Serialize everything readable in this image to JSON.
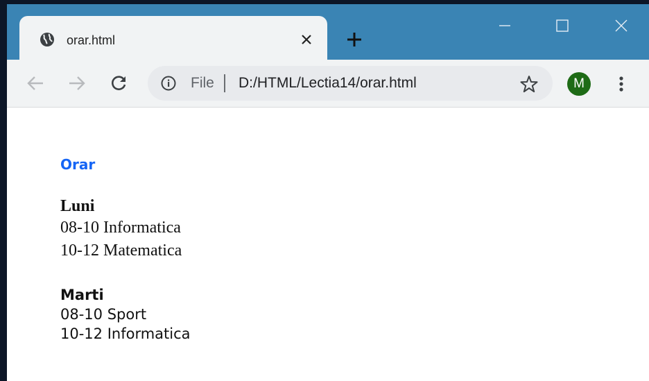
{
  "tab": {
    "title": "orar.html"
  },
  "toolbar": {
    "scheme_label": "File",
    "url": "D:/HTML/Lectia14/orar.html",
    "avatar_letter": "M"
  },
  "page": {
    "heading": "Orar",
    "days": [
      {
        "name": "Luni",
        "lessons": [
          "08-10 Informatica",
          "10-12 Matematica"
        ]
      },
      {
        "name": "Marti",
        "lessons": [
          "08-10 Sport",
          "10-12 Informatica"
        ]
      }
    ]
  },
  "colors": {
    "titlebar": "#3a84b4",
    "heading": "#1565f5",
    "avatar": "#1e6b16"
  }
}
